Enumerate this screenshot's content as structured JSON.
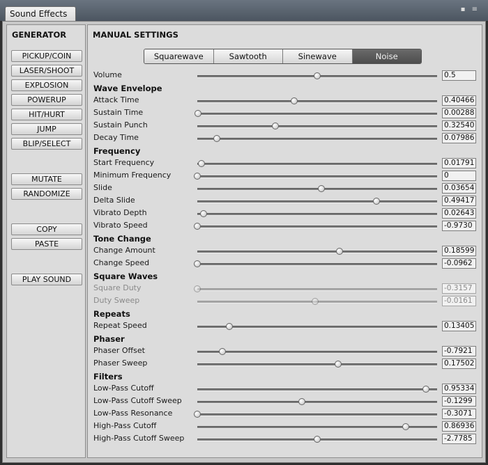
{
  "window": {
    "tab_title": "Sound Effects"
  },
  "generator": {
    "title": "GENERATOR",
    "buttons": [
      "PICKUP/COIN",
      "LASER/SHOOT",
      "EXPLOSION",
      "POWERUP",
      "HIT/HURT",
      "JUMP",
      "BLIP/SELECT"
    ],
    "actions": [
      "MUTATE",
      "RANDOMIZE"
    ],
    "clipboard": [
      "COPY",
      "PASTE"
    ],
    "play": "PLAY SOUND"
  },
  "manual": {
    "title": "MANUAL SETTINGS",
    "waveforms": [
      "Squarewave",
      "Sawtooth",
      "Sinewave",
      "Noise"
    ],
    "selected_waveform": "Noise",
    "volume": {
      "label": "Volume",
      "value": "0.5",
      "fraction": 0.5
    },
    "sections": [
      {
        "title": "Wave Envelope",
        "params": [
          {
            "label": "Attack Time",
            "value": "0.40466",
            "fraction": 0.405,
            "enabled": true
          },
          {
            "label": "Sustain Time",
            "value": "0.00288",
            "fraction": 0.003,
            "enabled": true
          },
          {
            "label": "Sustain Punch",
            "value": "0.32540",
            "fraction": 0.325,
            "enabled": true
          },
          {
            "label": "Decay Time",
            "value": "0.07986",
            "fraction": 0.08,
            "enabled": true
          }
        ]
      },
      {
        "title": "Frequency",
        "params": [
          {
            "label": "Start Frequency",
            "value": "0.01791",
            "fraction": 0.018,
            "enabled": true
          },
          {
            "label": "Minimum Frequency",
            "value": "0",
            "fraction": 0.0,
            "enabled": true
          },
          {
            "label": "Slide",
            "value": "0.03654",
            "fraction": 0.518,
            "enabled": true
          },
          {
            "label": "Delta Slide",
            "value": "0.49417",
            "fraction": 0.747,
            "enabled": true
          },
          {
            "label": "Vibrato Depth",
            "value": "0.02643",
            "fraction": 0.026,
            "enabled": true
          },
          {
            "label": "Vibrato Speed",
            "value": "-0.9730",
            "fraction": 0.0,
            "enabled": true
          }
        ]
      },
      {
        "title": "Tone Change",
        "params": [
          {
            "label": "Change Amount",
            "value": "0.18599",
            "fraction": 0.593,
            "enabled": true
          },
          {
            "label": "Change Speed",
            "value": "-0.0962",
            "fraction": 0.0,
            "enabled": true
          }
        ]
      },
      {
        "title": "Square Waves",
        "params": [
          {
            "label": "Square Duty",
            "value": "-0.3157",
            "fraction": 0.0,
            "enabled": false
          },
          {
            "label": "Duty Sweep",
            "value": "-0.0161",
            "fraction": 0.492,
            "enabled": false
          }
        ]
      },
      {
        "title": "Repeats",
        "params": [
          {
            "label": "Repeat Speed",
            "value": "0.13405",
            "fraction": 0.134,
            "enabled": true
          }
        ]
      },
      {
        "title": "Phaser",
        "params": [
          {
            "label": "Phaser Offset",
            "value": "-0.7921",
            "fraction": 0.104,
            "enabled": true
          },
          {
            "label": "Phaser Sweep",
            "value": "0.17502",
            "fraction": 0.588,
            "enabled": true
          }
        ]
      },
      {
        "title": "Filters",
        "params": [
          {
            "label": "Low-Pass Cutoff",
            "value": "0.95334",
            "fraction": 0.953,
            "enabled": true
          },
          {
            "label": "Low-Pass Cutoff Sweep",
            "value": "-0.1299",
            "fraction": 0.435,
            "enabled": true
          },
          {
            "label": "Low-Pass Resonance",
            "value": "-0.3071",
            "fraction": 0.0,
            "enabled": true
          },
          {
            "label": "High-Pass Cutoff",
            "value": "0.86936",
            "fraction": 0.869,
            "enabled": true
          },
          {
            "label": "High-Pass Cutoff Sweep",
            "value": "-2.7785",
            "fraction": 0.5,
            "enabled": true
          }
        ]
      }
    ]
  }
}
